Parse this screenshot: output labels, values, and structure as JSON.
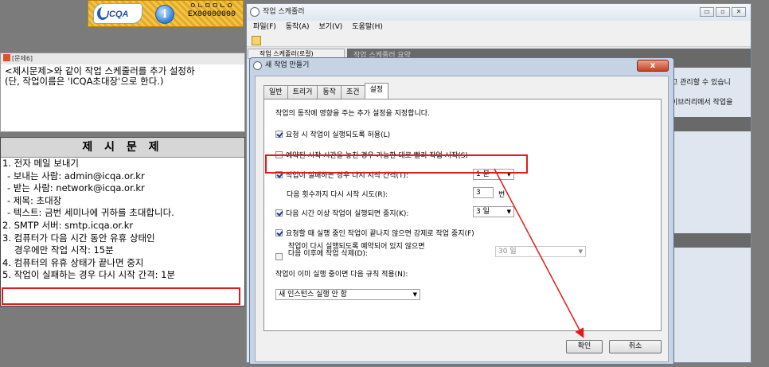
{
  "banner": {
    "logo_text": "ICQA",
    "code_dots": "ㅇㄴㅁㅁㄴㅇ",
    "exam_code": "EX00000000"
  },
  "question": {
    "title": "[문제6]",
    "line1": "<제시문제>와 같이 작업 스케줄러를 추가 설정하",
    "line2": "(단, 작업이름은 'ICQA초대장'으로 한다.)"
  },
  "spec": {
    "title": "제 시 문 제",
    "lines": [
      "1. 전자 메일 보내기",
      " - 보내는 사람: admin@icqa.or.kr",
      " - 받는 사람: network@icqa.or.kr",
      " - 제목: 초대장",
      " - 텍스트: 금번 세미나에 귀하를 초대합니다.",
      "2. SMTP 서버: smtp.icqa.or.kr",
      "3. 컴퓨터가 다음 시간 동안 유휴 상태인",
      "경우에만 작업 시작: 15분",
      "4. 컴퓨터의 유휴 상태가 끝나면 중지",
      "5. 작업이 실패하는 경우 다시 시작 간격: 1분"
    ]
  },
  "scheduler": {
    "title": "작업 스케줄러",
    "menu": [
      "파일(F)",
      "동작(A)",
      "보기(V)",
      "도움말(H)"
    ],
    "nav_item": "작업 스케줄러(로컬)",
    "bar_text": "작업 스케줄러 요약",
    "side_text1": "고 관리할 수 있습니",
    "side_text2": "이브러리에서 작업을"
  },
  "dialog": {
    "title": "새 작업 만들기",
    "close": "x",
    "tabs": [
      "일반",
      "트리거",
      "동작",
      "조건",
      "설정"
    ],
    "active_tab": "설정",
    "description": "작업의 동작에 영향을 주는 추가 설정을 지정합니다.",
    "opt_allow_demand": "요청 시 작업이 실행되도록 허용(L)",
    "opt_run_missed": "예약된 시작 시간을 놓친 경우 가능한 대로 빨리 작업 시작(S)",
    "opt_restart_fail": "작업이 실패하는 경우 다시 시작 간격(T):",
    "restart_interval": "1 분",
    "restart_attempts_label": "다음 횟수까지 다시 시작 시도(R):",
    "restart_attempts": "3",
    "restart_attempts_unit": "번",
    "opt_stop_long": "다음 시간 이상 작업이 실행되면 중지(K):",
    "stop_long_value": "3 일",
    "opt_force_stop": "요청할 때 실행 중인 작업이 끝나지 않으면 강제로 작업 중지(F)",
    "opt_delete_line1": "작업이 다시 실행되도록 예약되어 있지 않으면",
    "opt_delete_line2": "다음 이후에 작업 삭제(D):",
    "delete_value": "30 일",
    "rule_label": "작업이 이미 실행 중이면 다음 규칙 적용(N):",
    "rule_value": "새 인스턴스 실행 안 함",
    "ok": "확인",
    "cancel": "취소"
  },
  "colors": {
    "highlight": "#e21b1b",
    "background": "#7b7b7b"
  }
}
